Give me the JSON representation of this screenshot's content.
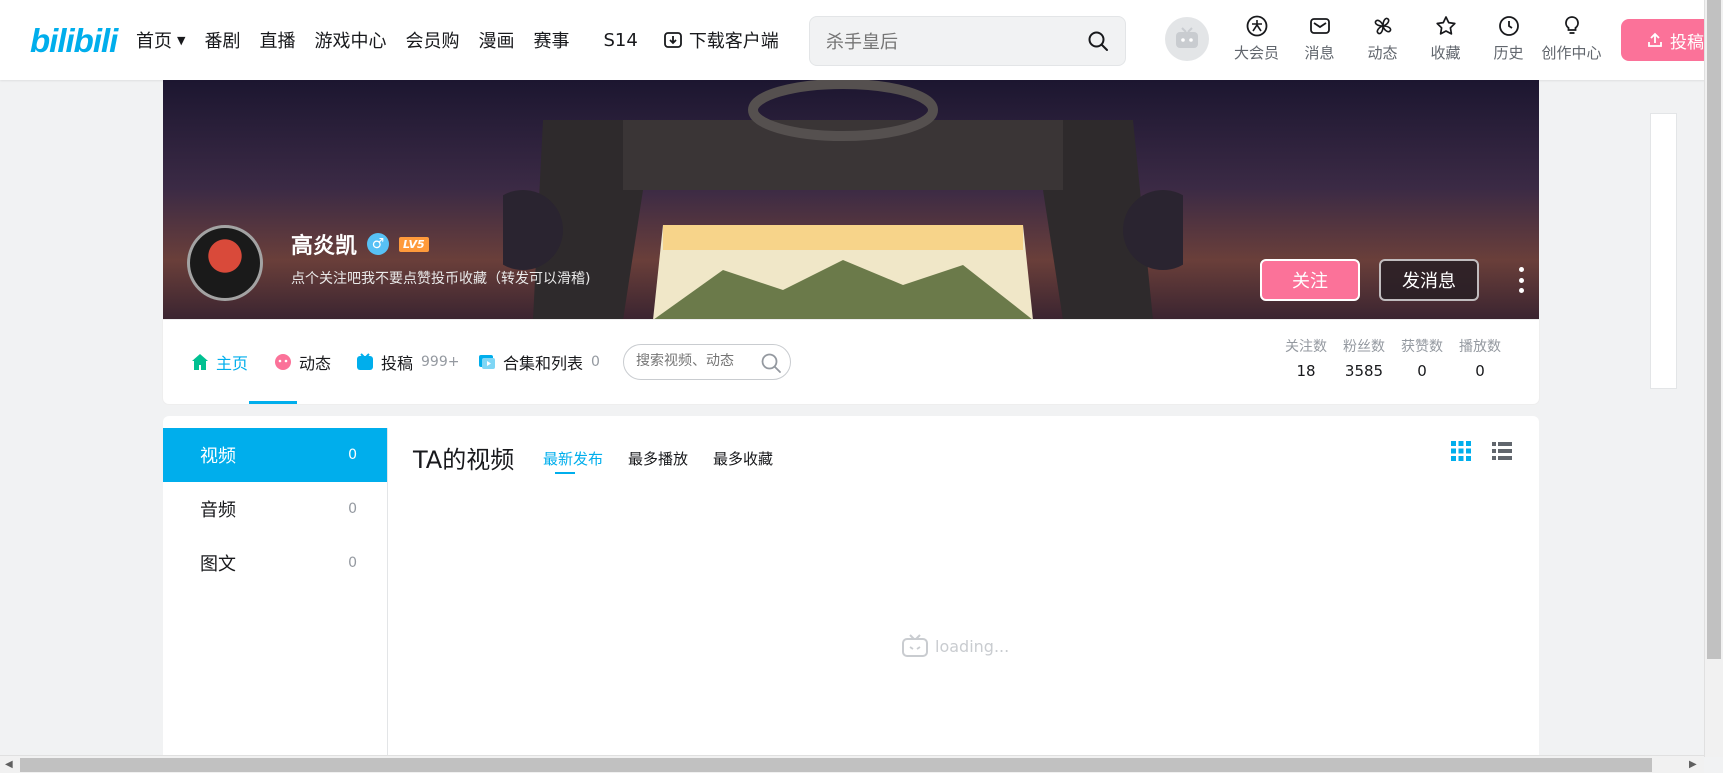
{
  "header": {
    "logo": "bilibili",
    "nav": [
      {
        "label": "首页",
        "has_dropdown": true
      },
      {
        "label": "番剧"
      },
      {
        "label": "直播"
      },
      {
        "label": "游戏中心"
      },
      {
        "label": "会员购"
      },
      {
        "label": "漫画"
      },
      {
        "label": "赛事"
      },
      {
        "label": "S14"
      },
      {
        "label": "下载客户端",
        "icon": "download-icon"
      }
    ],
    "search": {
      "placeholder": "杀手皇后"
    },
    "right_icons": [
      {
        "label": "大会员",
        "icon": "vip-icon"
      },
      {
        "label": "消息",
        "icon": "mail-icon"
      },
      {
        "label": "动态",
        "icon": "windmill-icon"
      },
      {
        "label": "收藏",
        "icon": "star-icon"
      },
      {
        "label": "历史",
        "icon": "clock-icon"
      },
      {
        "label": "创作中心",
        "icon": "lightbulb-icon"
      }
    ],
    "upload_label": "投稿"
  },
  "profile": {
    "name": "高炎凯",
    "level": "LV5",
    "gender": "♂",
    "signature": "点个关注吧我不要点赞投币收藏（转发可以滑稽)",
    "follow_label": "关注",
    "message_label": "发消息"
  },
  "tabs": [
    {
      "label": "主页",
      "icon": "home-icon",
      "active": true
    },
    {
      "label": "动态",
      "icon": "dynamic-icon"
    },
    {
      "label": "投稿",
      "icon": "upload-tab-icon",
      "count": "999+"
    },
    {
      "label": "合集和列表",
      "icon": "collection-icon",
      "count": "0"
    }
  ],
  "tab_search": {
    "placeholder": "搜索视频、动态"
  },
  "stats": [
    {
      "label": "关注数",
      "value": "18"
    },
    {
      "label": "粉丝数",
      "value": "3585"
    },
    {
      "label": "获赞数",
      "value": "0"
    },
    {
      "label": "播放数",
      "value": "0"
    }
  ],
  "left_nav": [
    {
      "label": "视频",
      "count": "0",
      "active": true
    },
    {
      "label": "音频",
      "count": "0"
    },
    {
      "label": "图文",
      "count": "0"
    }
  ],
  "content": {
    "title": "TA的视频",
    "sort_tabs": [
      "最新发布",
      "最多播放",
      "最多收藏"
    ],
    "loading_text": "loading..."
  },
  "colors": {
    "accent": "#00aeec",
    "pink": "#fb7299"
  }
}
